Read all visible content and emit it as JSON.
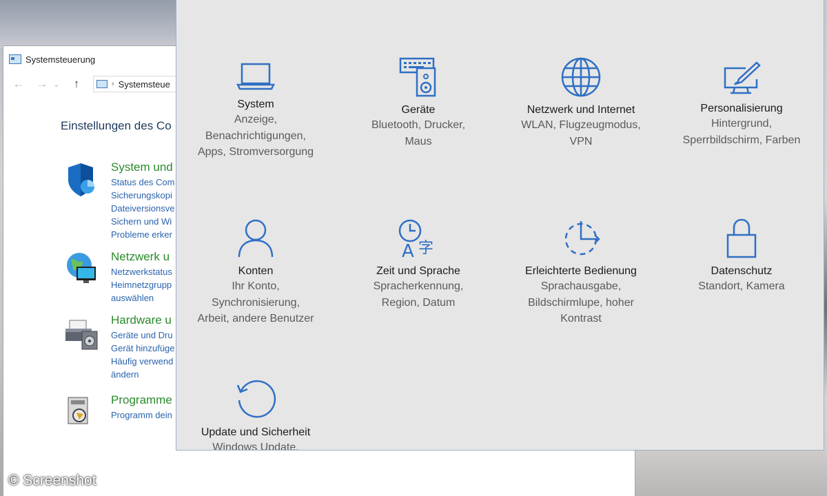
{
  "control_panel": {
    "window_title": "Systemsteuerung",
    "address": "Systemsteue",
    "heading": "Einstellungen des Co",
    "categories": [
      {
        "title": "System und",
        "links": [
          "Status des Com",
          "Sicherungskopi",
          "Dateiversionsve",
          "Sichern und Wi",
          "Probleme erker"
        ]
      },
      {
        "title": "Netzwerk u",
        "links": [
          "Netzwerkstatus",
          "Heimnetzgrupp",
          "auswählen"
        ]
      },
      {
        "title": "Hardware u",
        "links": [
          "Geräte und Dru",
          "Gerät hinzufüge",
          "Häufig verwend",
          "ändern"
        ]
      },
      {
        "title": "Programme",
        "links": [
          "Programm dein"
        ]
      }
    ]
  },
  "settings": {
    "tiles": [
      {
        "icon": "laptop-icon",
        "title": "System",
        "desc": [
          "Anzeige,",
          "Benachrichtigungen,",
          "Apps, Stromversorgung"
        ]
      },
      {
        "icon": "devices-icon",
        "title": "Geräte",
        "desc": [
          "Bluetooth, Drucker,",
          "Maus"
        ]
      },
      {
        "icon": "globe-icon",
        "title": "Netzwerk und Internet",
        "desc": [
          "WLAN, Flugzeugmodus,",
          "VPN"
        ]
      },
      {
        "icon": "personalization-icon",
        "title": "Personalisierung",
        "desc": [
          "Hintergrund,",
          "Sperrbildschirm, Farben"
        ]
      },
      {
        "icon": "person-icon",
        "title": "Konten",
        "desc": [
          "Ihr Konto,",
          "Synchronisierung,",
          "Arbeit, andere Benutzer"
        ]
      },
      {
        "icon": "time-language-icon",
        "title": "Zeit und Sprache",
        "desc": [
          "Spracherkennung,",
          "Region, Datum"
        ]
      },
      {
        "icon": "ease-of-access-icon",
        "title": "Erleichterte Bedienung",
        "desc": [
          "Sprachausgabe,",
          "Bildschirmlupe, hoher",
          "Kontrast"
        ]
      },
      {
        "icon": "lock-icon",
        "title": "Datenschutz",
        "desc": [
          "Standort, Kamera"
        ]
      },
      {
        "icon": "update-icon",
        "title": "Update und Sicherheit",
        "desc": [
          "Windows Update,"
        ]
      }
    ],
    "accent_color": "#2f6fc4"
  },
  "watermark": "© Screenshot"
}
